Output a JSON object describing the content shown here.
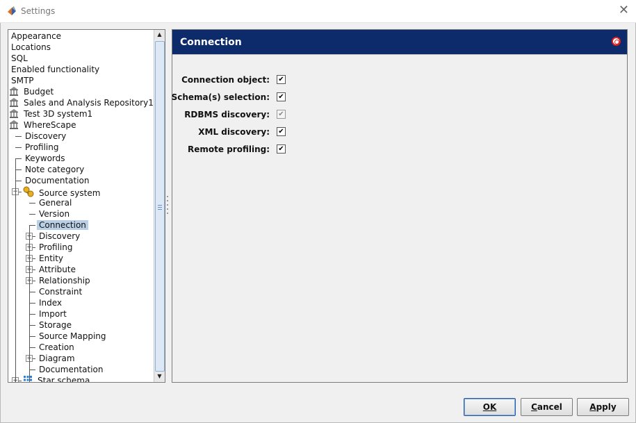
{
  "window": {
    "title": "Settings"
  },
  "tree": {
    "items": [
      {
        "label": "Appearance"
      },
      {
        "label": "Locations"
      },
      {
        "label": "SQL"
      },
      {
        "label": "Enabled functionality"
      },
      {
        "label": "SMTP"
      },
      {
        "label": "Budget",
        "icon": "bank-icon"
      },
      {
        "label": "Sales and Analysis Repository1",
        "icon": "bank-icon"
      },
      {
        "label": "Test 3D system1",
        "icon": "bank-icon"
      },
      {
        "label": "WhereScape",
        "icon": "bank-icon"
      },
      {
        "label": "Discovery"
      },
      {
        "label": "Profiling"
      },
      {
        "label": "Keywords"
      },
      {
        "label": "Note category"
      },
      {
        "label": "Documentation"
      },
      {
        "label": "Source system",
        "icon": "source-system-icon",
        "expanded": true
      },
      {
        "label": "General"
      },
      {
        "label": "Version"
      },
      {
        "label": "Connection",
        "selected": true
      },
      {
        "label": "Discovery",
        "expandable": true
      },
      {
        "label": "Profiling",
        "expandable": true
      },
      {
        "label": "Entity",
        "expandable": true
      },
      {
        "label": "Attribute",
        "expandable": true
      },
      {
        "label": "Relationship",
        "expandable": true
      },
      {
        "label": "Constraint"
      },
      {
        "label": "Index"
      },
      {
        "label": "Import"
      },
      {
        "label": "Storage"
      },
      {
        "label": "Source Mapping"
      },
      {
        "label": "Creation"
      },
      {
        "label": "Diagram",
        "expandable": true
      },
      {
        "label": "Documentation"
      },
      {
        "label": "Star schema",
        "icon": "star-schema-icon",
        "expandable": true
      }
    ]
  },
  "panel": {
    "title": "Connection",
    "fields": [
      {
        "label": "Connection object:",
        "checked": true,
        "enabled": true
      },
      {
        "label": "Schema(s) selection:",
        "checked": true,
        "enabled": true
      },
      {
        "label": "RDBMS discovery:",
        "checked": true,
        "enabled": false
      },
      {
        "label": "XML discovery:",
        "checked": true,
        "enabled": true
      },
      {
        "label": "Remote profiling:",
        "checked": true,
        "enabled": true
      }
    ]
  },
  "buttons": {
    "ok": {
      "label": "OK"
    },
    "cancel": {
      "label": "Cancel"
    },
    "apply": {
      "label": "Apply"
    }
  },
  "colors": {
    "header_bg": "#0d2a6b",
    "selection": "#b8cfe5"
  }
}
